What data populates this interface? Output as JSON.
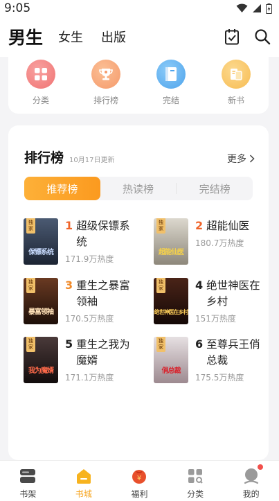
{
  "status": {
    "time": "9:05"
  },
  "top_nav": {
    "tabs": [
      {
        "label": "男生",
        "active": true
      },
      {
        "label": "女生",
        "active": false
      },
      {
        "label": "出版",
        "active": false
      }
    ],
    "icons": [
      "checklist-icon",
      "search-icon"
    ]
  },
  "quick": [
    {
      "label": "分类",
      "icon": "category-icon",
      "color": "#f47a7a"
    },
    {
      "label": "排行榜",
      "icon": "trophy-icon",
      "color": "#f7a173"
    },
    {
      "label": "完结",
      "icon": "book-icon",
      "color": "#5fb0f0"
    },
    {
      "label": "新书",
      "icon": "newbook-icon",
      "color": "#f9c667"
    }
  ],
  "ranking": {
    "title": "排行榜",
    "date": "10月17日更新",
    "more": "更多",
    "tabs": [
      "推荐榜",
      "热读榜",
      "完结榜"
    ],
    "books": [
      {
        "rank": "1",
        "name_l1": "超级保镖系",
        "name_l2": "统",
        "heat": "171.9万热度",
        "cover_text": "保镖系统",
        "tag": "独家",
        "rank_color": "#f0642a",
        "cover_bg": "#2a3546"
      },
      {
        "rank": "2",
        "name_l1": "超能仙医",
        "name_l2": "",
        "heat": "180.7万热度",
        "cover_text": "超能仙医",
        "tag": "独家",
        "rank_color": "#f0642a",
        "cover_bg": "#b7b2a6"
      },
      {
        "rank": "3",
        "name_l1": "重生之暴富",
        "name_l2": "领袖",
        "heat": "170.5万热度",
        "cover_text": "暴富领袖",
        "tag": "独家",
        "rank_color": "#f08a2a",
        "cover_bg": "#3a2418"
      },
      {
        "rank": "4",
        "name_l1": "绝世神医在",
        "name_l2": "乡村",
        "heat": "151万热度",
        "cover_text": "绝世神医在乡村",
        "tag": "独家",
        "rank_color": "#222222",
        "cover_bg": "#2a140e"
      },
      {
        "rank": "5",
        "name_l1": "重生之我为",
        "name_l2": "魔婿",
        "heat": "171.1万热度",
        "cover_text": "我为魔婿",
        "tag": "独家",
        "rank_color": "#222222",
        "cover_bg": "#1c1414"
      },
      {
        "rank": "6",
        "name_l1": "至尊兵王俏",
        "name_l2": "总裁",
        "heat": "175.5万热度",
        "cover_text": "俏总裁",
        "tag": "独家",
        "rank_color": "#222222",
        "cover_bg": "#c8c3c6"
      }
    ]
  },
  "bottom_nav": [
    {
      "label": "书架",
      "icon": "bookshelf-icon",
      "active": false
    },
    {
      "label": "书城",
      "icon": "bookstore-icon",
      "active": true
    },
    {
      "label": "福利",
      "icon": "welfare-icon",
      "active": false
    },
    {
      "label": "分类",
      "icon": "category-grid-icon",
      "active": false
    },
    {
      "label": "我的",
      "icon": "profile-icon",
      "active": false,
      "badge": true
    }
  ],
  "colors": {
    "accent": "#f6a623",
    "accent_gradient_end": "#fb9a1f",
    "badge": "#f2504b"
  }
}
